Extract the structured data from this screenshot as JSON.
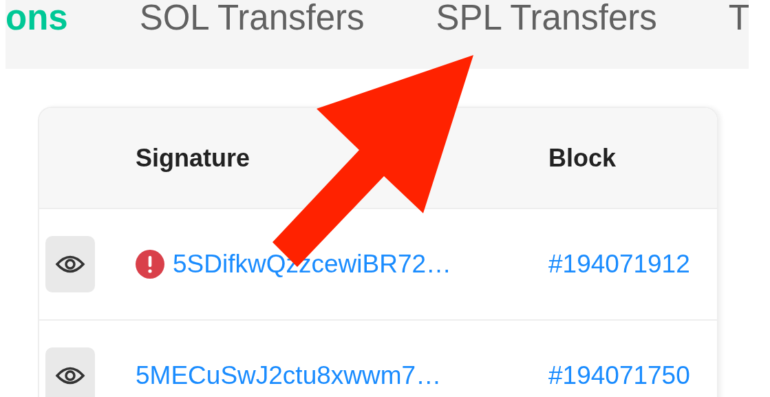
{
  "tabs": [
    {
      "label": "ons",
      "selected": true
    },
    {
      "label": "SOL Transfers",
      "selected": false
    },
    {
      "label": "SPL Transfers",
      "selected": false
    },
    {
      "label": "T",
      "selected": false
    }
  ],
  "table": {
    "columns": [
      "Signature",
      "Block"
    ],
    "rows": [
      {
        "signature": "5SDifkwQzzcewiBR72…",
        "error": true,
        "block": "#194071912"
      },
      {
        "signature": "5MECuSwJ2ctu8xwwm7…",
        "error": false,
        "block": "#194071750"
      }
    ]
  }
}
